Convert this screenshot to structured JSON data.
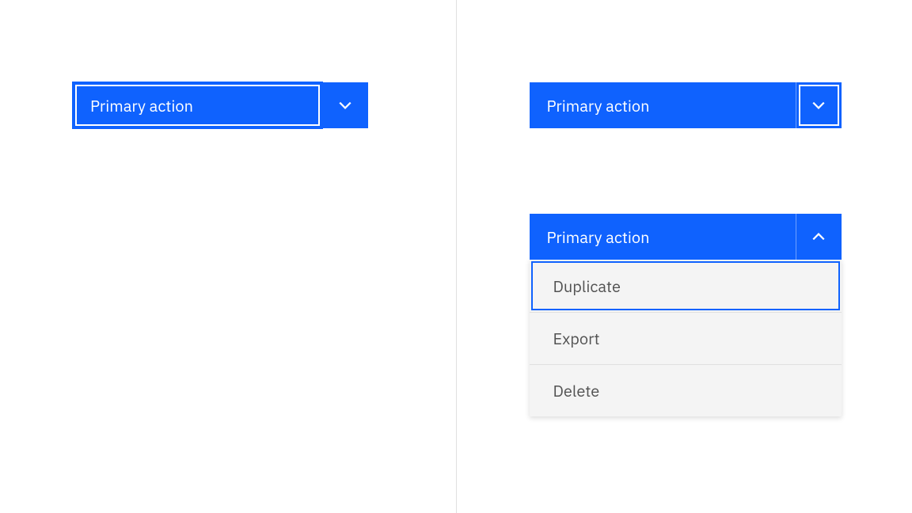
{
  "left": {
    "primary_label": "Primary action"
  },
  "right_closed": {
    "primary_label": "Primary action"
  },
  "right_open": {
    "primary_label": "Primary action",
    "menu_items": {
      "0": "Duplicate",
      "1": "Export",
      "2": "Delete"
    }
  },
  "colors": {
    "primary": "#0f62fe",
    "menu_bg": "#f4f4f4"
  }
}
